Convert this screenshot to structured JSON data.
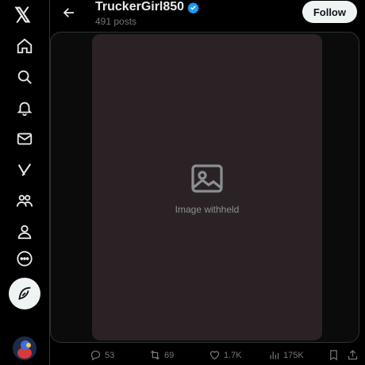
{
  "app": {
    "logo": "𝕏"
  },
  "nav": {
    "items": [
      {
        "icon": "home-icon"
      },
      {
        "icon": "search-icon"
      },
      {
        "icon": "bell-icon"
      },
      {
        "icon": "mail-icon"
      },
      {
        "icon": "grok-icon"
      },
      {
        "icon": "communities-icon"
      },
      {
        "icon": "profile-icon"
      },
      {
        "icon": "more-icon"
      }
    ],
    "compose_icon": "feather-icon"
  },
  "header": {
    "account_name": "TruckerGirl850",
    "post_count": "491 posts",
    "follow_label": "Follow",
    "verified_color": "#1d9bf0"
  },
  "media": {
    "placeholder_text": "Image withheld"
  },
  "engagement": {
    "replies": "53",
    "reposts": "69",
    "likes": "1.7K",
    "views": "175K"
  },
  "colors": {
    "background": "#000000",
    "text": "#e7e9ea",
    "muted": "#71767b",
    "button_bg": "#eff3f4"
  }
}
